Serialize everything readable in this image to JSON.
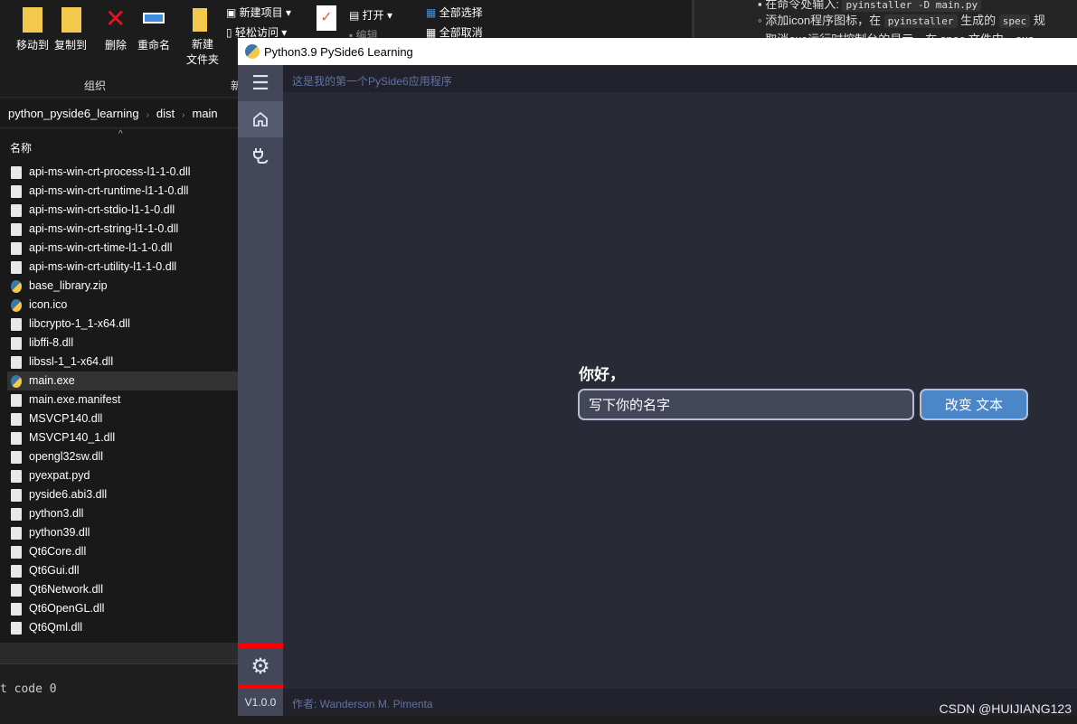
{
  "explorer": {
    "ribbon": {
      "move_to": "移动到",
      "copy_to": "复制到",
      "delete": "删除",
      "rename": "重命名",
      "new_folder_line1": "新建",
      "new_folder_line2": "文件夹",
      "new_item": "新建项目",
      "easy_access": "轻松访问",
      "open": "打开",
      "edit": "编辑",
      "select_all": "全部选择",
      "select_none": "全部取消",
      "group_organize": "组织",
      "group_new": "新"
    },
    "breadcrumb": [
      "python_pyside6_learning",
      "dist",
      "main"
    ],
    "column_name": "名称",
    "files": [
      {
        "name": "api-ms-win-crt-process-l1-1-0.dll",
        "type": "dll"
      },
      {
        "name": "api-ms-win-crt-runtime-l1-1-0.dll",
        "type": "dll"
      },
      {
        "name": "api-ms-win-crt-stdio-l1-1-0.dll",
        "type": "dll"
      },
      {
        "name": "api-ms-win-crt-string-l1-1-0.dll",
        "type": "dll"
      },
      {
        "name": "api-ms-win-crt-time-l1-1-0.dll",
        "type": "dll"
      },
      {
        "name": "api-ms-win-crt-utility-l1-1-0.dll",
        "type": "dll"
      },
      {
        "name": "base_library.zip",
        "type": "py"
      },
      {
        "name": "icon.ico",
        "type": "py"
      },
      {
        "name": "libcrypto-1_1-x64.dll",
        "type": "dll"
      },
      {
        "name": "libffi-8.dll",
        "type": "dll"
      },
      {
        "name": "libssl-1_1-x64.dll",
        "type": "dll"
      },
      {
        "name": "main.exe",
        "type": "py",
        "selected": true
      },
      {
        "name": "main.exe.manifest",
        "type": "dll"
      },
      {
        "name": "MSVCP140.dll",
        "type": "dll"
      },
      {
        "name": "MSVCP140_1.dll",
        "type": "dll"
      },
      {
        "name": "opengl32sw.dll",
        "type": "dll"
      },
      {
        "name": "pyexpat.pyd",
        "type": "dll"
      },
      {
        "name": "pyside6.abi3.dll",
        "type": "dll"
      },
      {
        "name": "python3.dll",
        "type": "dll"
      },
      {
        "name": "python39.dll",
        "type": "dll"
      },
      {
        "name": "Qt6Core.dll",
        "type": "dll"
      },
      {
        "name": "Qt6Gui.dll",
        "type": "dll"
      },
      {
        "name": "Qt6Network.dll",
        "type": "dll"
      },
      {
        "name": "Qt6OpenGL.dll",
        "type": "dll"
      },
      {
        "name": "Qt6Qml.dll",
        "type": "dll"
      }
    ]
  },
  "markdown": {
    "line1_pre": "在命令处输入: ",
    "line1_code": "pyinstaller -D main.py",
    "line2_pre": "添加icon程序图标，在 ",
    "line2_code1": "pyinstaller",
    "line2_mid": " 生成的 ",
    "line2_code2": "spec",
    "line2_post": " 规",
    "line3": "取消exe运行时控制台的显示，在 spec 文件中，exe"
  },
  "terminal": {
    "text": "t code 0"
  },
  "app": {
    "window_title": "Python3.9 PySide6 Learning",
    "top_bar_text": "这是我的第一个PySide6应用程序",
    "greeting": "你好，",
    "name_input_value": "写下你的名字",
    "change_button": "改变 文本",
    "version": "V1.0.0",
    "footer": "作者: Wanderson M. Pimenta",
    "sidebar_icons": [
      "menu-icon",
      "home-icon",
      "plug-icon",
      "gear-icon"
    ],
    "accent_color": "#4a86c8",
    "highlight_color": "#ff0000"
  },
  "watermark": "CSDN @HUIJIANG123"
}
